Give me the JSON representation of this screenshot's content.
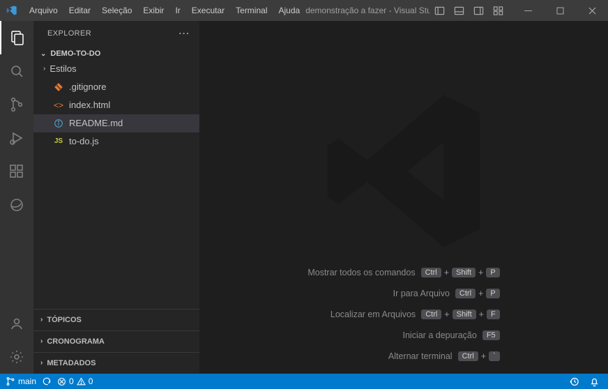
{
  "menu": {
    "items": [
      "Arquivo",
      "Editar",
      "Seleção",
      "Exibir",
      "Ir",
      "Executar",
      "Terminal",
      "Ajuda"
    ]
  },
  "title": "demonstração a fazer - Visual Studio Code",
  "explorer": {
    "header": "EXPLORER",
    "root": "DEMO-TO-DO",
    "files": [
      {
        "name": "Estilos",
        "kind": "folder"
      },
      {
        "name": ".gitignore",
        "kind": "git"
      },
      {
        "name": "index.html",
        "kind": "html"
      },
      {
        "name": "README.md",
        "kind": "info",
        "selected": true
      },
      {
        "name": "to-do.js",
        "kind": "js"
      }
    ],
    "sections": [
      "TÓPICOS",
      "CRONOGRAMA",
      "METADADOS"
    ]
  },
  "commands": [
    {
      "label": "Mostrar todos os comandos",
      "keys": [
        "Ctrl",
        "Shift",
        "P"
      ]
    },
    {
      "label": "Ir para Arquivo",
      "keys": [
        "Ctrl",
        "P"
      ]
    },
    {
      "label": "Localizar em Arquivos",
      "keys": [
        "Ctrl",
        "Shift",
        "F"
      ]
    },
    {
      "label": "Iniciar a depuração",
      "keys": [
        "F5"
      ]
    },
    {
      "label": "Alternar terminal",
      "keys": [
        "Ctrl",
        "`"
      ]
    }
  ],
  "statusbar": {
    "branch": "main",
    "errors": "0",
    "warnings": "0"
  }
}
